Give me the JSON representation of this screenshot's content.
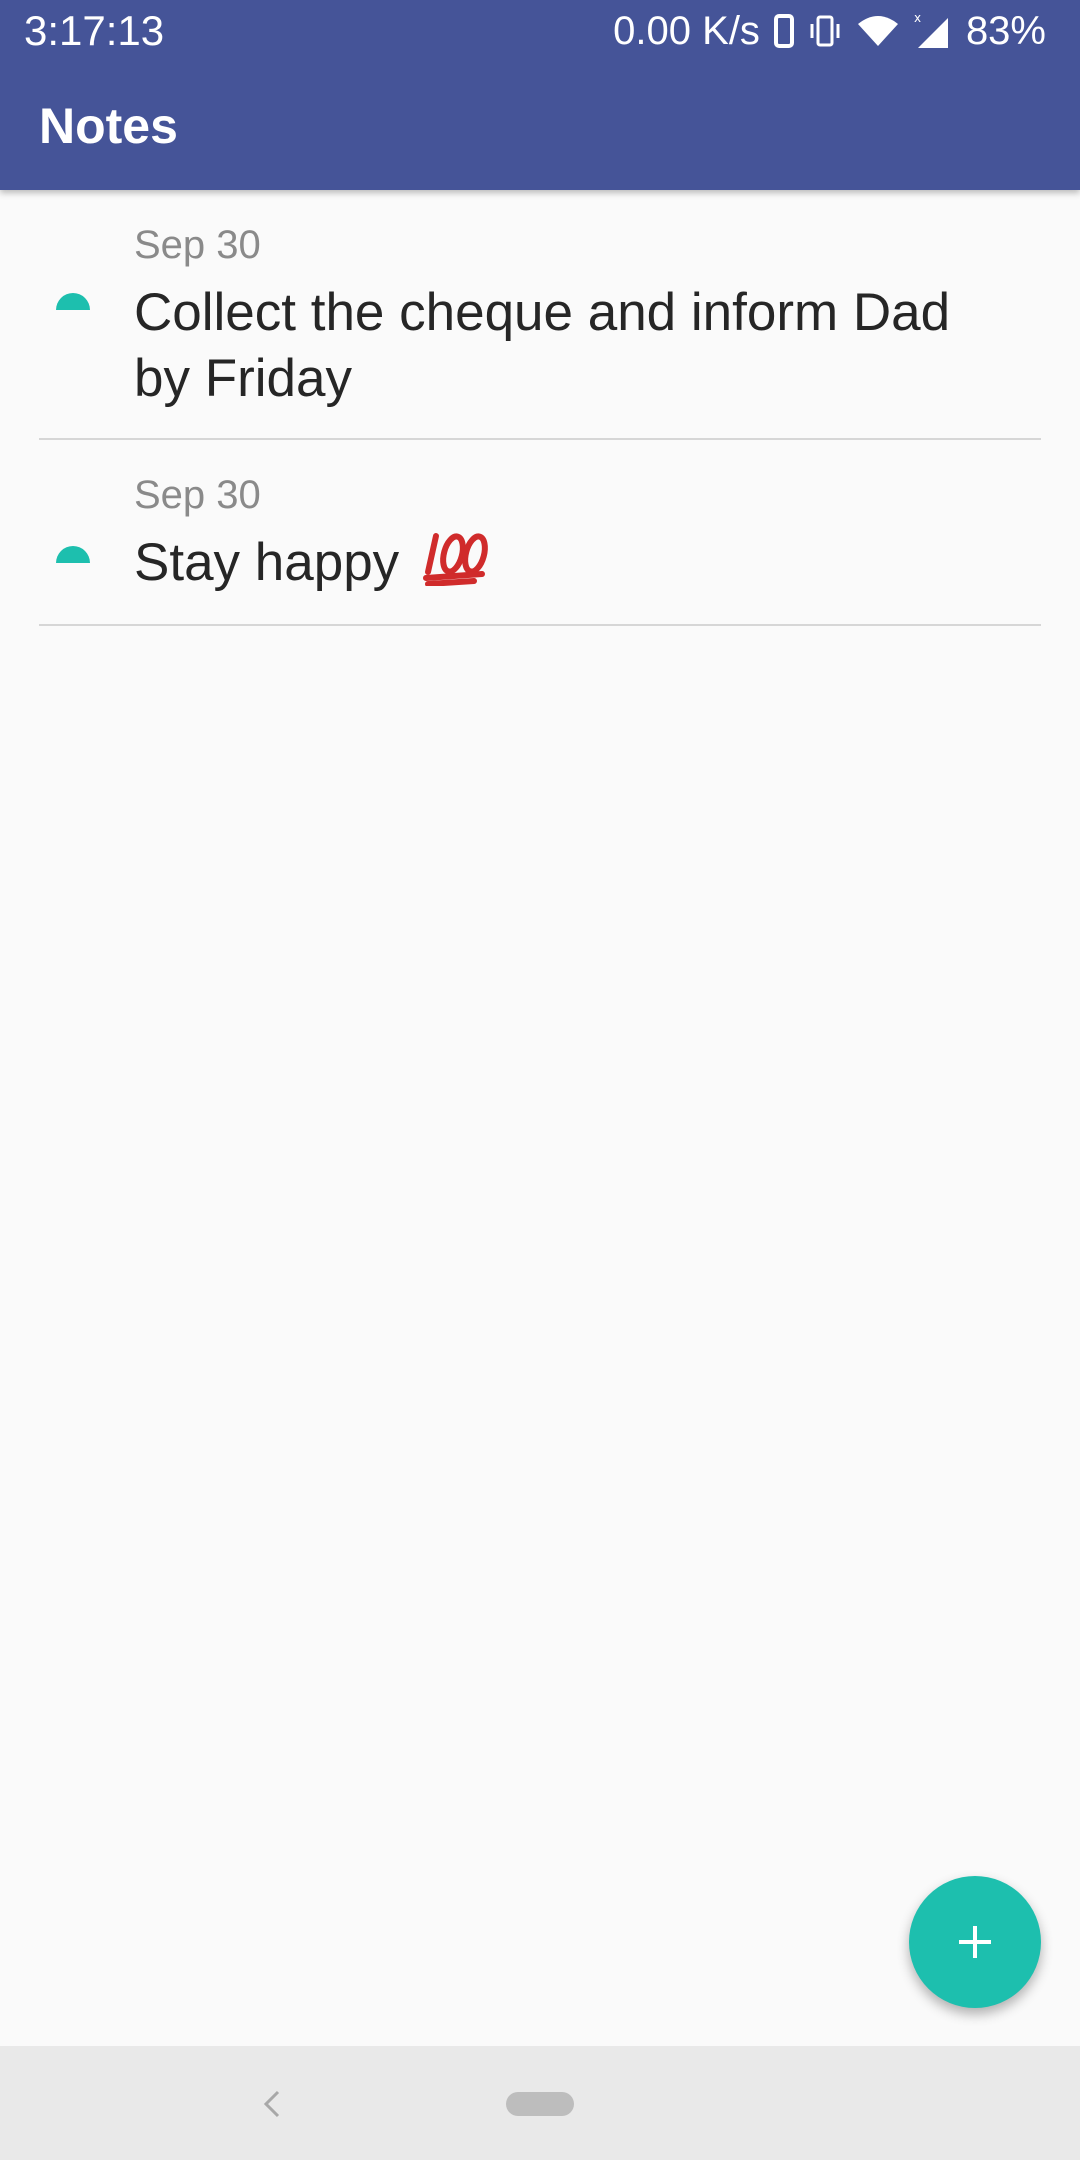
{
  "status_bar": {
    "time": "3:17:13",
    "net_speed": "0.00 K/s",
    "battery": "83%",
    "icons": [
      "phone-outline-icon",
      "vibrate-icon",
      "wifi-icon",
      "cell-signal-icon"
    ]
  },
  "app_bar": {
    "title": "Notes",
    "color": "#455498"
  },
  "notes": [
    {
      "date": "Sep 30",
      "text": "Collect the cheque and inform Dad by Friday",
      "marker_color": "#1dbfae"
    },
    {
      "date": "Sep 30",
      "text": "Stay happy",
      "emoji": "hundred-points-icon",
      "marker_color": "#1dbfae"
    }
  ],
  "fab": {
    "icon": "plus-icon",
    "color": "#1dbfae"
  },
  "nav_bar": {
    "icons": [
      "back-chevron-icon",
      "home-pill-icon"
    ]
  }
}
